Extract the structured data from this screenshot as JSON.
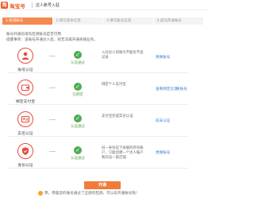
{
  "header": {
    "logo_text": "淘宝号",
    "title": "达人账号入驻"
  },
  "steps": [
    {
      "label": "1.检测账号"
    },
    {
      "label": "2.填写基本信息"
    },
    {
      "label": "3.填写账号信息"
    },
    {
      "label": "4.成功开通账号"
    }
  ],
  "intro": {
    "line1": "账号开通前请先检测账号是否可用",
    "line2": "提醒事项：该账号开通达人后，则无法再开通商铺业务。"
  },
  "rows": [
    {
      "label": "账号认证",
      "status": "认证通过",
      "desc": "入驻达人的账号不能有不良记录",
      "action": "更换账号",
      "icon": "user-icon"
    },
    {
      "label": "绑定支付宝",
      "status": "已绑定",
      "desc": "绑定个人支付宝",
      "action": "查看绑定信息",
      "action2": "换账号",
      "icon": "wallet-icon"
    },
    {
      "label": "实名认证",
      "status": "认证通过",
      "desc": "支付宝完成实名认证",
      "action": "前去认证",
      "icon": "idcard-icon"
    },
    {
      "label": "身份认证",
      "status": "认证通过",
      "desc": "同一身份证下关联的所有账户，只能创建一个达人账户和开设一家店铺",
      "action": "更换账号",
      "icon": "shield-icon"
    }
  ],
  "button": {
    "label": "开通"
  },
  "footer": {
    "note": "恭，恭喜您的账号通过了全部的检测，可以去开通账号啦！"
  },
  "colors": {
    "accent": "#f05a24",
    "step_active": "#f5894f",
    "ok": "#4caf50",
    "link": "#3a7bd5"
  }
}
